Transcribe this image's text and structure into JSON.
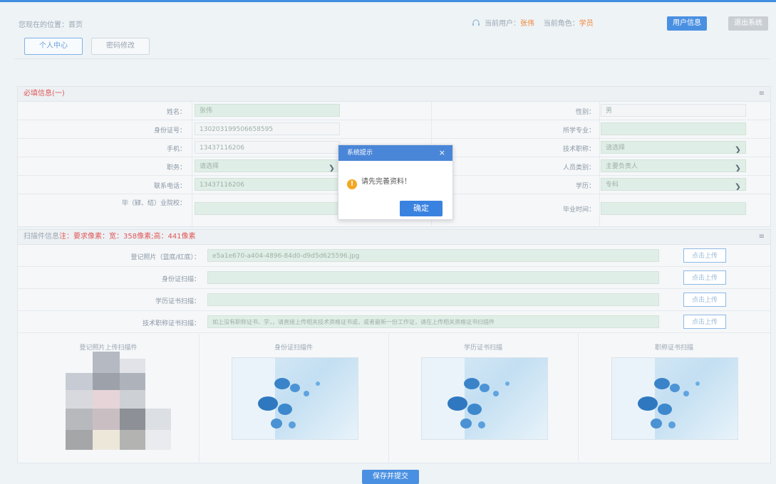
{
  "breadcrumb": "您现在的位置：首页",
  "header": {
    "user_label": "当前用户：",
    "user_value": "张伟",
    "role_label": "当前角色：",
    "role_value": "学员",
    "user_center_btn": "用户信息",
    "logout_btn": "退出系统"
  },
  "tabs": [
    {
      "label": "个人中心"
    },
    {
      "label": "密码修改"
    }
  ],
  "section1": {
    "title": "必填信息(一)",
    "collapse": "≡",
    "rows": [
      {
        "left_label": "姓名：",
        "left_value": "张伟",
        "right_label": "性别：",
        "right_value": "男"
      },
      {
        "left_label": "身份证号：",
        "left_value": "130203199506658595",
        "right_label": "所学专业：",
        "right_value": ""
      },
      {
        "left_label": "手机：",
        "left_value": "13437116206",
        "right_label": "技术职称：",
        "right_value": "请选择"
      },
      {
        "left_label": "职务：",
        "left_value": "请选择",
        "right_label": "人员类别：",
        "right_value": "主要负责人"
      },
      {
        "left_label": "联系电话：",
        "left_value": "13437116206",
        "right_label": "学历：",
        "right_value": "专科"
      },
      {
        "left_label": "毕（肄、结）业院校：",
        "left_value": "",
        "right_label": "毕业时间：",
        "right_value": ""
      }
    ]
  },
  "section2": {
    "title_gray": "扫描件信息",
    "title_red": "注：要求像素：宽：358像素;高：441像素",
    "collapse": "≡",
    "uploads": [
      {
        "label": "登记照片（蓝底/红底）：",
        "value": "e5a1e670-a404-4896-84d0-d9d5d625596.jpg",
        "button": "点击上传"
      },
      {
        "label": "身份证扫描：",
        "value": "",
        "button": "点击上传"
      },
      {
        "label": "学历证书扫描：",
        "value": "",
        "button": "点击上传"
      },
      {
        "label": "技术职称证书扫描：",
        "value": "如上没有职称证书、学，，请直接上传相关技术资格证书或，或者最新一份工作证，请在上传相关资格证书扫描件",
        "button": "点击上传"
      }
    ],
    "previews": [
      {
        "label": "登记照片上传扫描件"
      },
      {
        "label": "身份证扫描件"
      },
      {
        "label": "学历证书扫描"
      },
      {
        "label": "职称证书扫描"
      }
    ]
  },
  "modal": {
    "title": "系统提示",
    "close": "×",
    "message": "请先完善资料！",
    "ok": "确定"
  },
  "save_button": "保存并提交",
  "colors": {
    "accent": "#4a90e2",
    "warning": "#f5a623",
    "required_title": "#e05858",
    "field_fill": "#dfeee6"
  }
}
